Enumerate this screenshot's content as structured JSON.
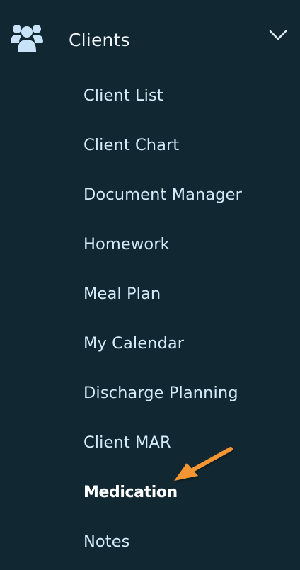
{
  "colors": {
    "background": "#112832",
    "header_text": "#f2f6f8",
    "item_text": "#d6ebfa",
    "icon": "#c8e2f8",
    "arrow": "#f39530"
  },
  "section": {
    "icon": "users-icon",
    "title": "Clients",
    "expanded": true,
    "chevron_icon": "chevron-down-icon"
  },
  "items": [
    {
      "label": "Client List"
    },
    {
      "label": "Client Chart"
    },
    {
      "label": "Document Manager"
    },
    {
      "label": "Homework"
    },
    {
      "label": "Meal Plan"
    },
    {
      "label": "My Calendar"
    },
    {
      "label": "Discharge Planning"
    },
    {
      "label": "Client MAR"
    },
    {
      "label": "Medication",
      "active": true
    },
    {
      "label": "Notes"
    }
  ],
  "annotation": {
    "icon": "arrow-pointer-icon",
    "target": "Medication"
  }
}
